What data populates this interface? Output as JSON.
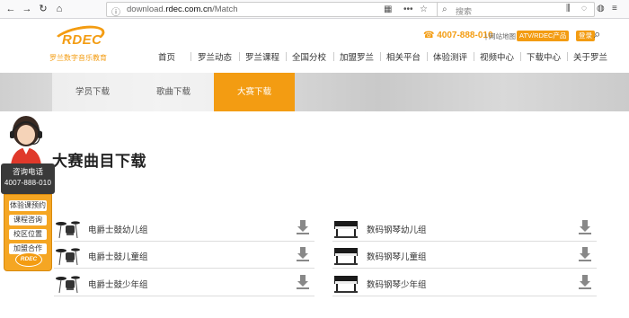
{
  "browser": {
    "url_prefix": "download.",
    "url_domain": "rdec.com.cn",
    "url_path": "/Match",
    "search_placeholder": "搜索"
  },
  "header": {
    "logo_text": "RDEC",
    "logo_caption": "罗兰数字音乐教育",
    "hotline": "☎ 4007-888-010",
    "sitemap": "| 网站地图",
    "atv_button": "ATV/RDEC产品",
    "login_button": "登录",
    "nav": [
      "首页",
      "罗兰动态",
      "罗兰课程",
      "全国分校",
      "加盟罗兰",
      "相关平台",
      "体验测评",
      "视频中心",
      "下载中心",
      "关于罗兰"
    ]
  },
  "tabs": [
    {
      "label": "学员下载",
      "active": false
    },
    {
      "label": "歌曲下载",
      "active": false
    },
    {
      "label": "大赛下载",
      "active": true
    }
  ],
  "main": {
    "title": "大赛曲目下载",
    "left_items": [
      {
        "label": "电爵士鼓幼儿组",
        "icon": "drum-kit-icon"
      },
      {
        "label": "电爵士鼓儿童组",
        "icon": "drum-kit-icon"
      },
      {
        "label": "电爵士鼓少年组",
        "icon": "drum-kit-icon"
      }
    ],
    "right_items": [
      {
        "label": "数码钢琴幼儿组",
        "icon": "digital-piano-icon"
      },
      {
        "label": "数码钢琴儿童组",
        "icon": "digital-piano-icon"
      },
      {
        "label": "数码钢琴少年组",
        "icon": "digital-piano-icon"
      }
    ]
  },
  "consult": {
    "title": "咨询电话",
    "phone": "4007-888-010",
    "menu": [
      "体验课预约",
      "课程咨询",
      "校区位置",
      "加盟合作"
    ],
    "logo_text": "RDEC"
  },
  "colors": {
    "accent": "#f39c12"
  }
}
